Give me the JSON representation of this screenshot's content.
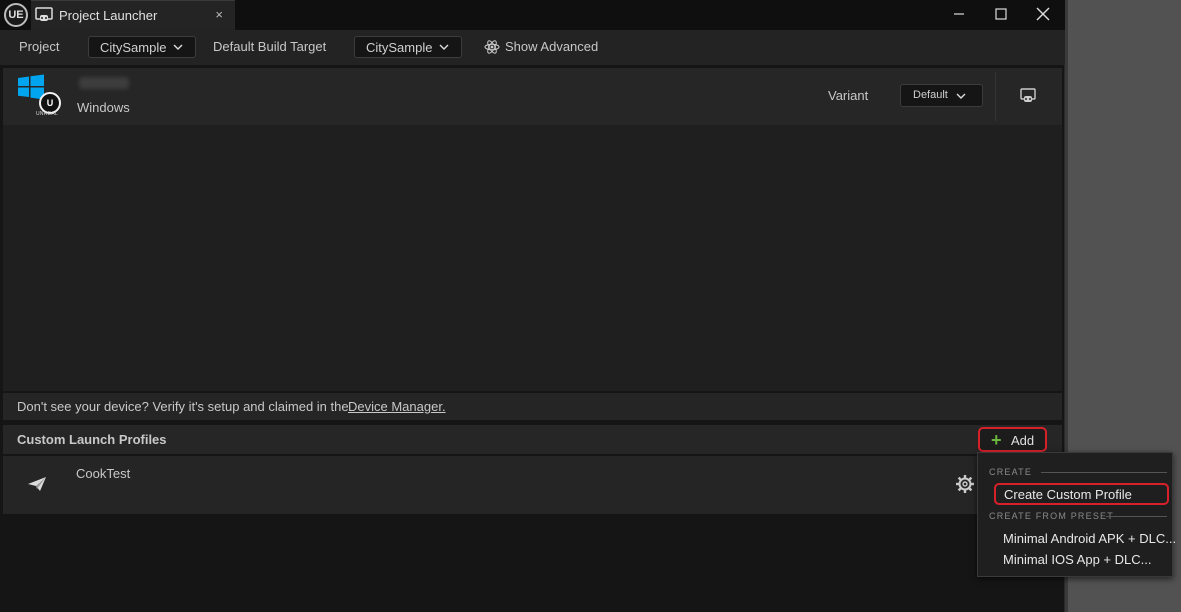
{
  "title_bar": {
    "app_logo": "UE",
    "tab_title": "Project Launcher",
    "tab_close": "×"
  },
  "toolbar": {
    "project_label": "Project",
    "project_value": "CitySample",
    "build_target_label": "Default Build Target",
    "build_target_value": "CitySample",
    "show_advanced_label": "Show Advanced"
  },
  "device": {
    "platform": "Windows",
    "logo_text": "UNREAL",
    "variant_label": "Variant",
    "variant_value": "Default"
  },
  "hint": {
    "text": "Don't see your device? Verify it's setup and claimed in the",
    "link": "Device Manager."
  },
  "profiles": {
    "title": "Custom Launch Profiles",
    "add_label": "Add",
    "items": [
      {
        "name": "CookTest"
      }
    ]
  },
  "menu": {
    "section_create": "CREATE",
    "create_custom": "Create Custom Profile",
    "section_preset": "CREATE FROM PRESET",
    "preset_android": "Minimal Android APK + DLC...",
    "preset_ios": "Minimal IOS App + DLC..."
  },
  "colors": {
    "window_bg": "#151515",
    "panel_bg": "#262626",
    "highlight_red": "#d8202a",
    "plus_green": "#6ab73c",
    "windows_blue": "#00a4ef"
  }
}
